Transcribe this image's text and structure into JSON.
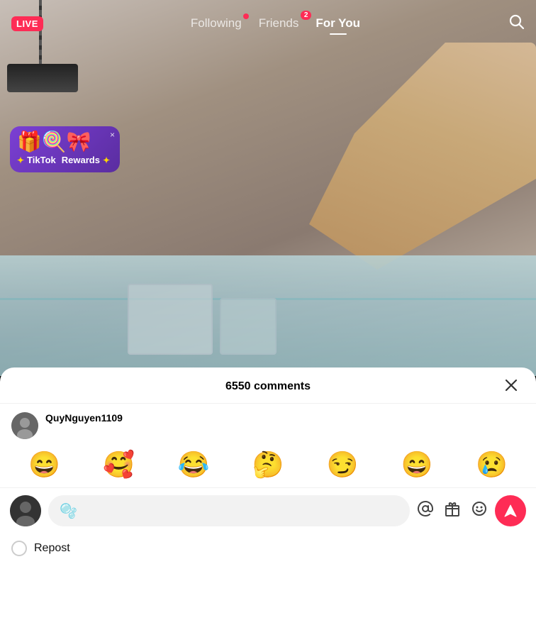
{
  "nav": {
    "live_label": "LIVE",
    "tabs": [
      {
        "id": "following",
        "label": "Following",
        "active": false,
        "dot": true,
        "badge": null
      },
      {
        "id": "friends",
        "label": "Friends",
        "active": false,
        "dot": false,
        "badge": "2"
      },
      {
        "id": "for_you",
        "label": "For You",
        "active": true,
        "dot": false,
        "badge": null
      }
    ]
  },
  "rewards": {
    "title": "TikTok",
    "subtitle": "Rewards",
    "icons": "🎁🍭🎀",
    "close": "×"
  },
  "comments": {
    "header": "6550 comments",
    "close": "×",
    "user": "QuyNguyen1109"
  },
  "emojis": [
    "😄",
    "🥰",
    "😂",
    "🤔",
    "😏",
    "😄",
    "😢"
  ],
  "input": {
    "blob_emoji": "🫧",
    "at_icon": "@",
    "gift_icon": "🎁",
    "face_icon": "🙂"
  },
  "repost": {
    "label": "Repost"
  }
}
